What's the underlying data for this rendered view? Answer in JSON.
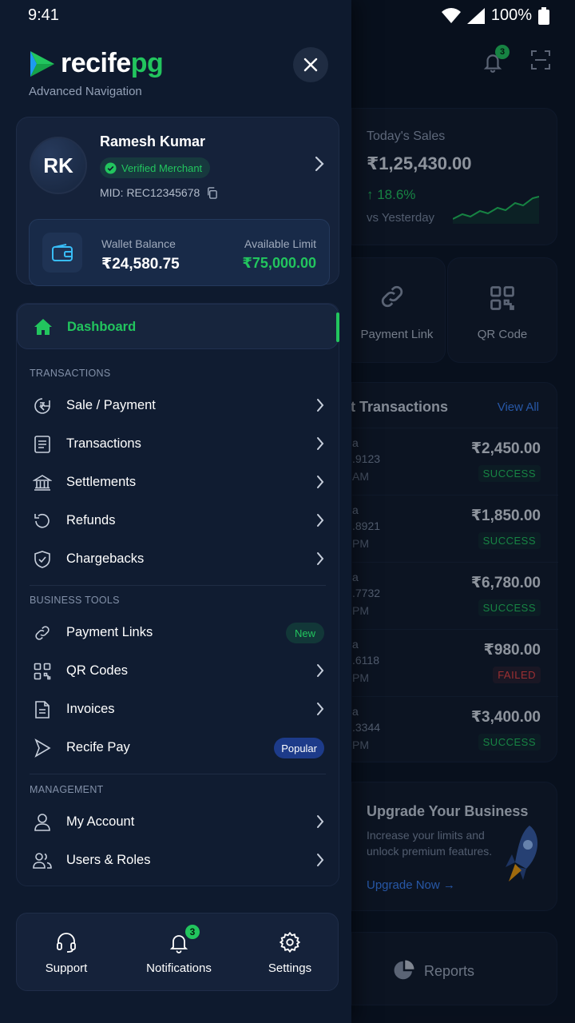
{
  "status_bar": {
    "time": "9:41",
    "battery": "100%"
  },
  "drawer": {
    "brand": {
      "name_main": "recife",
      "name_accent": "pg",
      "subtitle": "Advanced Navigation"
    },
    "profile": {
      "initials": "RK",
      "name": "Ramesh Kumar",
      "verified_label": "Verified Merchant",
      "mid": "MID: REC12345678",
      "wallet_label": "Wallet Balance",
      "wallet_value": "₹24,580.75",
      "limit_label": "Available Limit",
      "limit_value": "₹75,000.00"
    },
    "dashboard": {
      "label": "Dashboard"
    },
    "sections": {
      "transactions": {
        "title": "TRANSACTIONS",
        "items": [
          {
            "label": "Sale / Payment",
            "icon": "rupee-icon"
          },
          {
            "label": "Transactions",
            "icon": "document-icon"
          },
          {
            "label": "Settlements",
            "icon": "bank-icon"
          },
          {
            "label": "Refunds",
            "icon": "undo-icon"
          },
          {
            "label": "Chargebacks",
            "icon": "shield-icon"
          }
        ]
      },
      "business_tools": {
        "title": "BUSINESS TOOLS",
        "items": [
          {
            "label": "Payment Links",
            "icon": "link-icon",
            "badge": "New"
          },
          {
            "label": "QR Codes",
            "icon": "qr-icon"
          },
          {
            "label": "Invoices",
            "icon": "invoice-icon"
          },
          {
            "label": "Recife Pay",
            "icon": "play-icon",
            "badge": "Popular"
          }
        ]
      },
      "management": {
        "title": "MANAGEMENT",
        "items": [
          {
            "label": "My Account",
            "icon": "user-icon"
          },
          {
            "label": "Users & Roles",
            "icon": "users-icon"
          }
        ]
      }
    },
    "bottom_bar": {
      "support": "Support",
      "notifications": "Notifications",
      "notifications_badge": "3",
      "settings": "Settings"
    }
  },
  "background": {
    "bell_badge": "3",
    "sales": {
      "title": "Today's Sales",
      "amount": "₹1,25,430.00",
      "change": "↑ 18.6%",
      "vs": "vs Yesterday"
    },
    "quick_actions": [
      "Payment Link",
      "QR Code"
    ],
    "recent": {
      "title": "t Transactions",
      "view_all": "View All",
      "rows": [
        {
          "l1": "a",
          "l2": ".9123",
          "l3": "AM",
          "amount": "₹2,450.00",
          "status": "SUCCESS"
        },
        {
          "l1": "a",
          "l2": ".8921",
          "l3": "PM",
          "amount": "₹1,850.00",
          "status": "SUCCESS"
        },
        {
          "l1": "a",
          "l2": ".7732",
          "l3": "PM",
          "amount": "₹6,780.00",
          "status": "SUCCESS"
        },
        {
          "l1": "a",
          "l2": ".6118",
          "l3": "PM",
          "amount": "₹980.00",
          "status": "FAILED"
        },
        {
          "l1": "a",
          "l2": ".3344",
          "l3": "PM",
          "amount": "₹3,400.00",
          "status": "SUCCESS"
        }
      ]
    },
    "upgrade": {
      "title": "Upgrade Your Business",
      "desc": "Increase your limits and unlock premium features.",
      "link": "Upgrade Now →"
    },
    "reports": "Reports"
  },
  "colors": {
    "accent_green": "#22c55e",
    "accent_blue": "#3b82f6",
    "failed_red": "#ef4444",
    "drawer_bg": "#0e1a2e"
  }
}
